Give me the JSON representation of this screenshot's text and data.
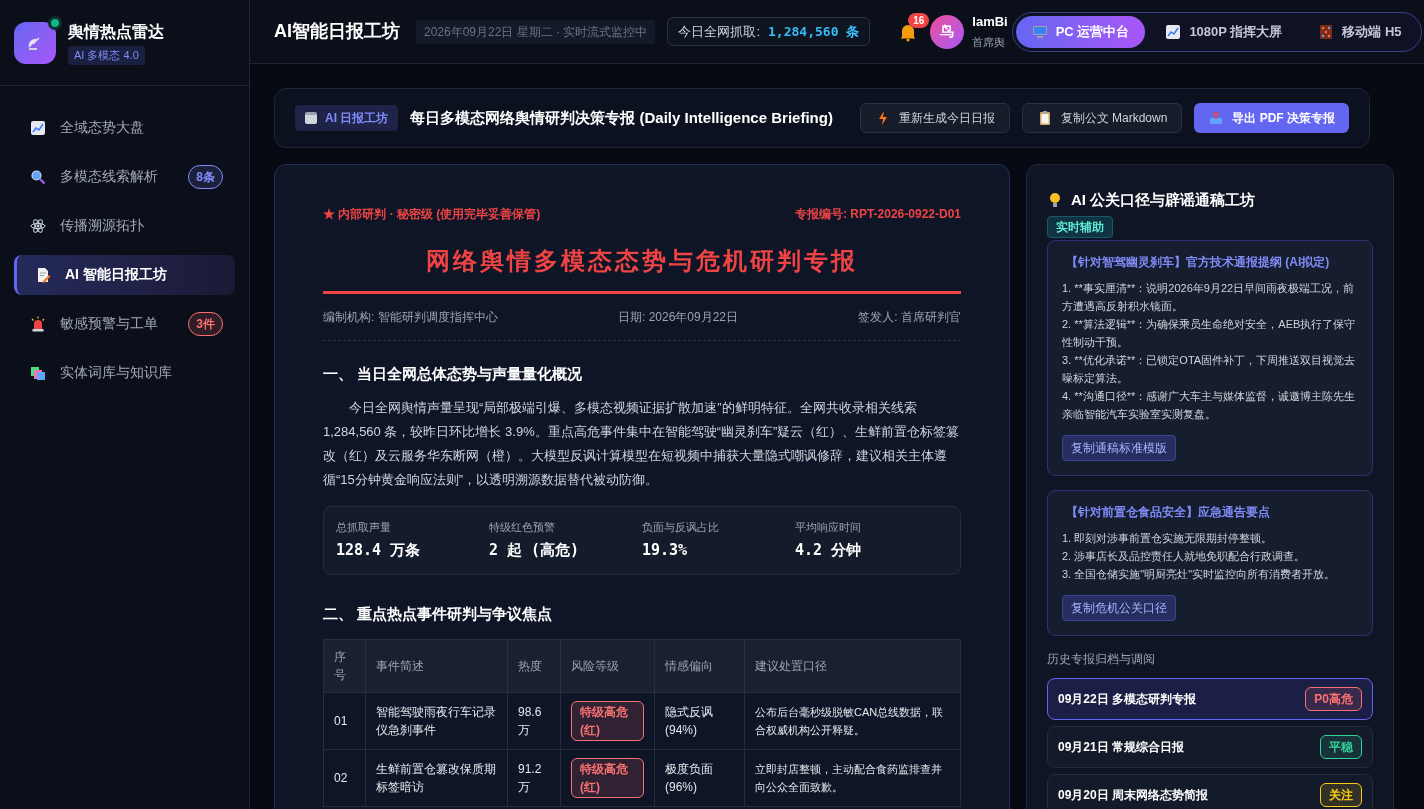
{
  "brand": {
    "title": "舆情热点雷达",
    "version": "AI 多模态 4.0",
    "online": true
  },
  "sidebar": {
    "items": [
      {
        "label": "全域态势大盘",
        "selected": false
      },
      {
        "label": "多模态线索解析",
        "selected": false,
        "badge": "8条",
        "color": "#818cf8"
      },
      {
        "label": "传播溯源拓扑",
        "selected": false
      },
      {
        "label": "AI 智能日报工坊",
        "selected": true
      },
      {
        "label": "敏感预警与工单",
        "selected": false,
        "badge": "3件",
        "color": "#f87171"
      },
      {
        "label": "实体词库与知识库",
        "selected": false
      }
    ]
  },
  "header": {
    "title": "AI智能日报工坊",
    "date": "2026年09月22日 星期二 · 实时流式监控中",
    "capture_label": "今日全网抓取:",
    "capture_value": "1,284,560 条",
    "notifications": "16",
    "user": {
      "avatar": "鸟",
      "name": "IamBi",
      "role": "首席舆"
    },
    "views": [
      {
        "label": "PC 运营中台",
        "selected": true
      },
      {
        "label": "1080P 指挥大屏",
        "selected": false
      },
      {
        "label": "移动端 H5",
        "selected": false
      }
    ]
  },
  "toolbar": {
    "tag": "AI 日报工坊",
    "title": "每日多模态网络舆情研判决策专报 (Daily Intelligence Briefing)",
    "buttons": [
      {
        "label": "重新生成今日日报",
        "primary": false
      },
      {
        "label": "复制公文 Markdown",
        "primary": false
      },
      {
        "label": "导出 PDF 决策专报",
        "primary": true
      }
    ]
  },
  "report": {
    "classification": "★ 内部研判 · 秘密级 (使用完毕妥善保管)",
    "number": "专报编号: RPT-2026-0922-D01",
    "title": "网络舆情多模态态势与危机研判专报",
    "meta": [
      "编制机构: 智能研判调度指挥中心",
      "日期: 2026年09月22日",
      "签发人: 首席研判官"
    ],
    "section_1": "一、 当日全网总体态势与声量量化概况",
    "summary": "今日全网舆情声量呈现“局部极端引爆、多模态视频证据扩散加速”的鲜明特征。全网共收录相关线索 1,284,560 条，较昨日环比增长 3.9%。重点高危事件集中在智能驾驶“幽灵刹车”疑云（红）、生鲜前置仓标签篡改（红）及云服务华东断网（橙）。大模型反讽计算模型在短视频中捕获大量隐式嘲讽修辞，建议相关主体遵循“15分钟黄金响应法则”，以透明溯源数据替代被动防御。",
    "stats": [
      {
        "label": "总抓取声量",
        "value": "128.4 万条"
      },
      {
        "label": "特级红色预警",
        "value": "2 起 (高危)"
      },
      {
        "label": "负面与反讽占比",
        "value": "19.3%"
      },
      {
        "label": "平均响应时间",
        "value": "4.2 分钟"
      }
    ],
    "section_2": "二、 重点热点事件研判与争议焦点",
    "table": {
      "columns": [
        "序号",
        "事件简述",
        "热度",
        "风险等级",
        "情感偏向",
        "建议处置口径"
      ],
      "rows": [
        {
          "no": "01",
          "event": "智能驾驶雨夜行车记录仪急刹事件",
          "heat": "98.6 万",
          "risk": "特级高危 (红)",
          "color": "#f87171",
          "sentiment": "隐式反讽 (94%)",
          "advice": "公布后台毫秒级脱敏CAN总线数据，联合权威机构公开释疑。"
        },
        {
          "no": "02",
          "event": "生鲜前置仓篡改保质期标签暗访",
          "heat": "91.2 万",
          "risk": "特级高危 (红)",
          "color": "#f87171",
          "sentiment": "极度负面 (96%)",
          "advice": "立即封店整顿，主动配合食药监排查并向公众全面致歉。"
        }
      ]
    }
  },
  "assistant": {
    "title": "AI 公关口径与辟谣通稿工坊",
    "tag": "实时辅助",
    "cards": [
      {
        "title": "【针对智驾幽灵刹车】官方技术通报提纲 (AI拟定)",
        "lines": [
          "1. **事实厘清**：说明2026年9月22日早间雨夜极端工况，前方遭遇高反射积水镜面。",
          "2. **算法逻辑**：为确保乘员生命绝对安全，AEB执行了保守性制动干预。",
          "3. **优化承诺**：已锁定OTA固件补丁，下周推送双目视觉去噪标定算法。",
          "4. **沟通口径**：感谢广大车主与媒体监督，诚邀博主陈先生亲临智能汽车实验室实测复盘。"
        ],
        "button": "复制通稿标准模版"
      },
      {
        "title": "【针对前置仓食品安全】应急通告要点",
        "lines": [
          "1. 即刻对涉事前置仓实施无限期封停整顿。",
          "2. 涉事店长及品控责任人就地免职配合行政调查。",
          "3. 全国仓储实施\"明厨亮灶\"实时监控向所有消费者开放。"
        ],
        "button": "复制危机公关口径"
      }
    ],
    "history_title": "历史专报归档与调阅",
    "history": [
      {
        "label": "09月22日 多模态研判专报",
        "tag": "P0高危",
        "color": "#f87171",
        "selected": true
      },
      {
        "label": "09月21日 常规综合日报",
        "tag": "平稳",
        "color": "#34d399",
        "selected": false
      },
      {
        "label": "09月20日 周末网络态势简报",
        "tag": "关注",
        "color": "#facc15",
        "selected": false
      }
    ]
  }
}
